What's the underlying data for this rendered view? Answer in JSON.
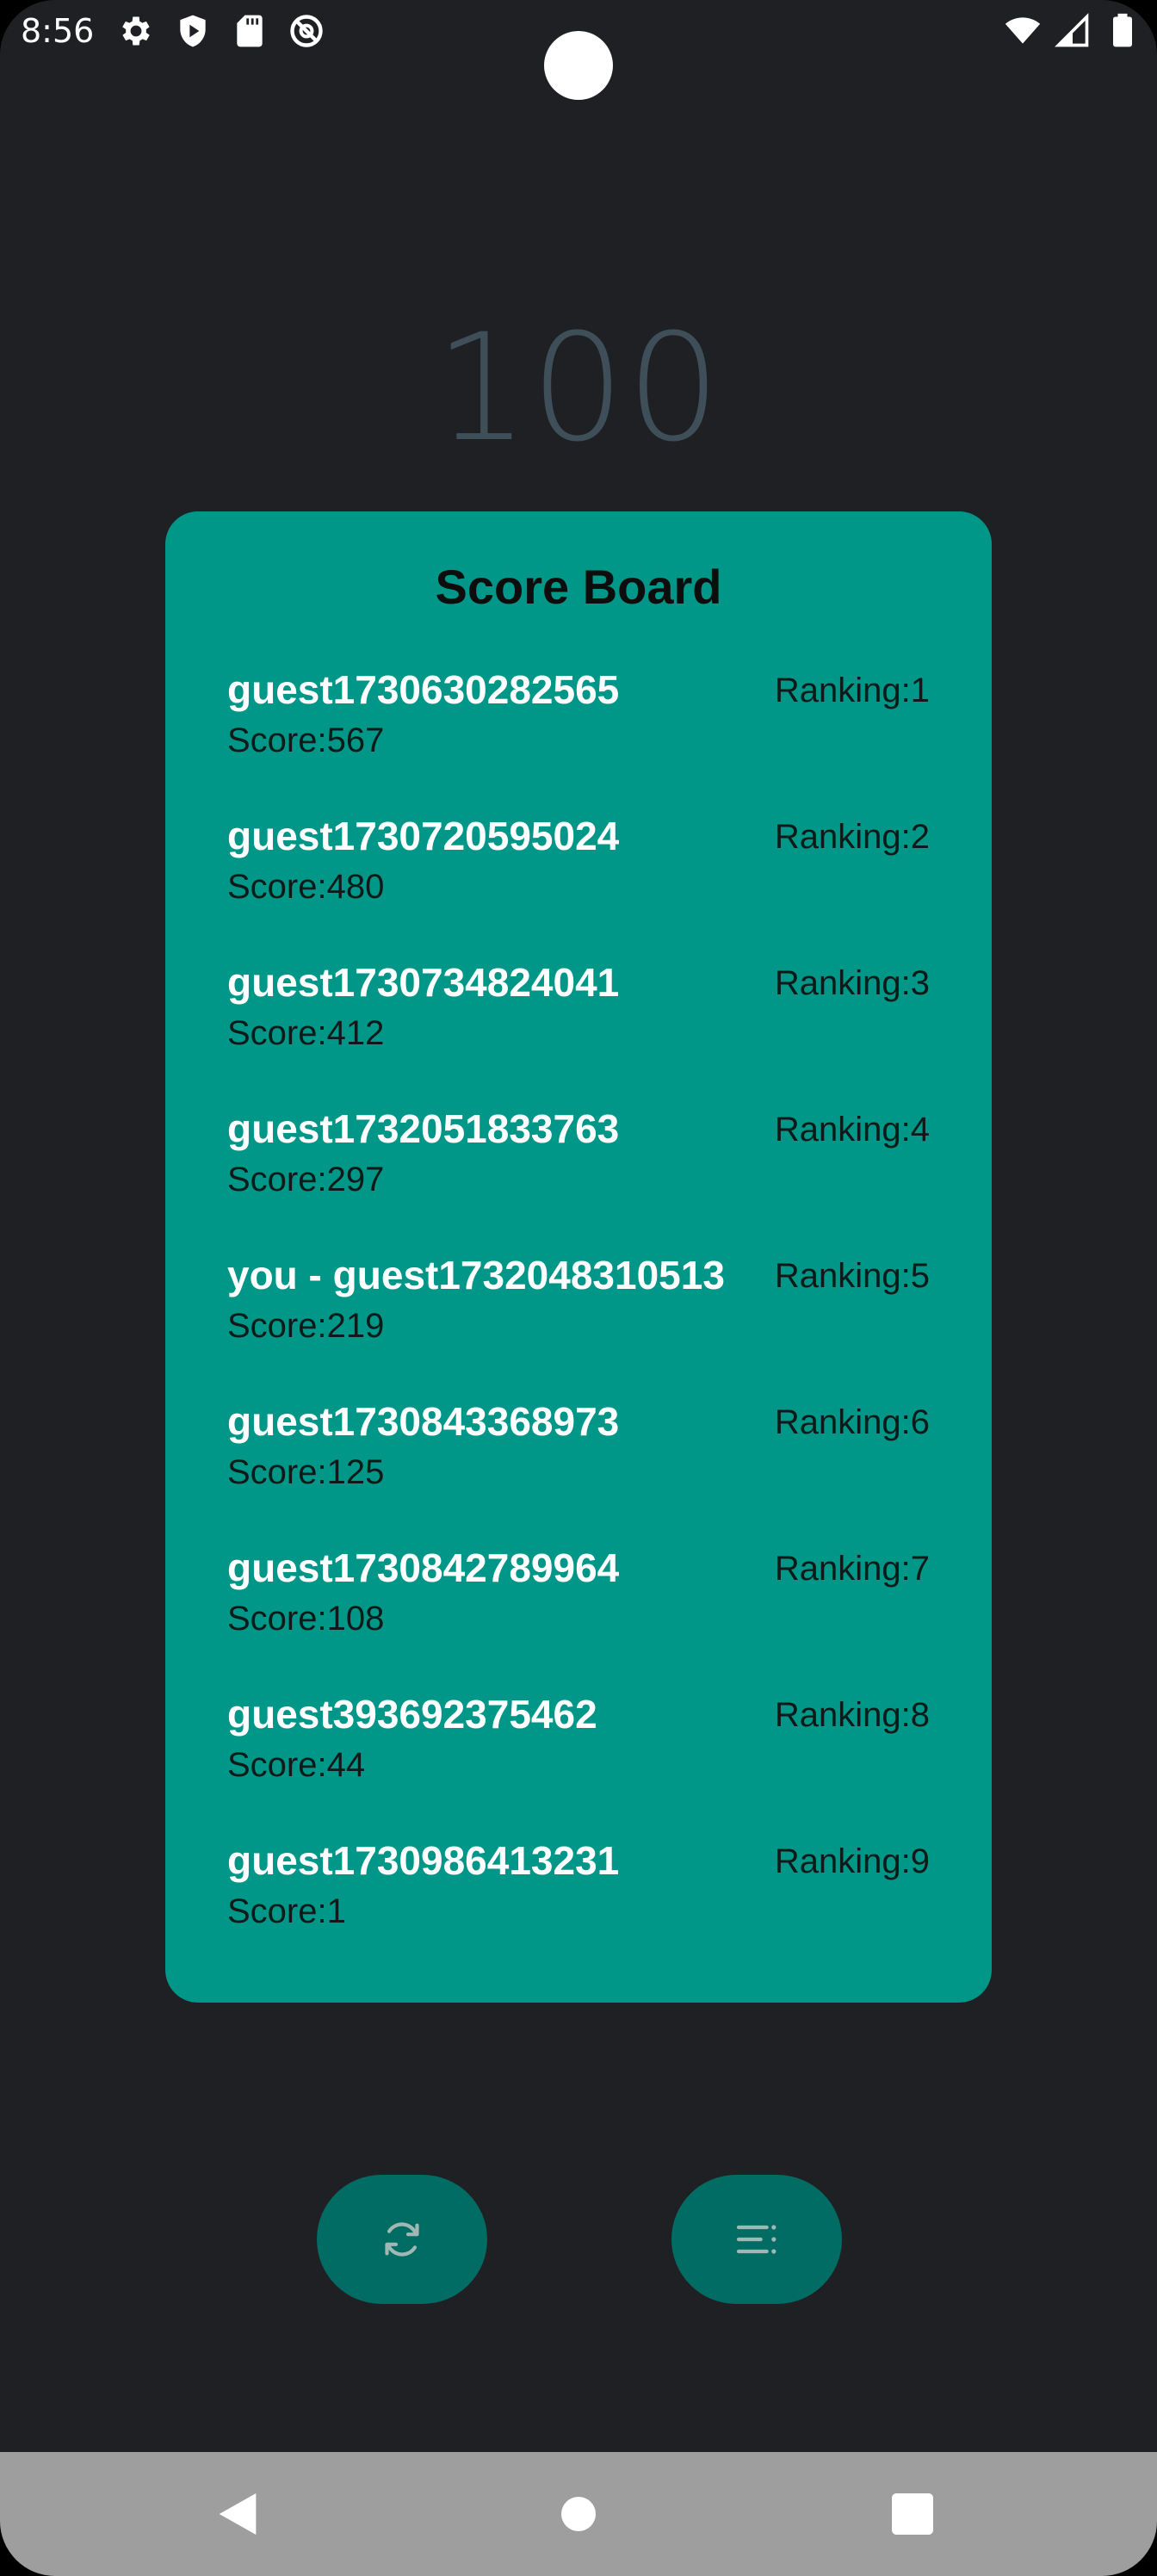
{
  "status_bar": {
    "time": "8:56",
    "icons_left": [
      "settings-icon",
      "shield-icon",
      "sd-card-icon",
      "no-disturb-icon"
    ],
    "icons_right": [
      "wifi-icon",
      "signal-icon",
      "battery-icon"
    ]
  },
  "game": {
    "current_score": "100"
  },
  "score_board": {
    "title": "Score Board",
    "entries": [
      {
        "player": "guest1730630282565",
        "score": "Score:567",
        "ranking": "Ranking:1"
      },
      {
        "player": "guest1730720595024",
        "score": "Score:480",
        "ranking": "Ranking:2"
      },
      {
        "player": "guest1730734824041",
        "score": "Score:412",
        "ranking": "Ranking:3"
      },
      {
        "player": "guest1732051833763",
        "score": "Score:297",
        "ranking": "Ranking:4"
      },
      {
        "player": "you - guest1732048310513",
        "score": "Score:219",
        "ranking": "Ranking:5"
      },
      {
        "player": "guest1730843368973",
        "score": "Score:125",
        "ranking": "Ranking:6"
      },
      {
        "player": "guest1730842789964",
        "score": "Score:108",
        "ranking": "Ranking:7"
      },
      {
        "player": "guest393692375462",
        "score": "Score:44",
        "ranking": "Ranking:8"
      },
      {
        "player": "guest1730986413231",
        "score": "Score:1",
        "ranking": "Ranking:9"
      }
    ]
  },
  "actions": {
    "refresh_icon": "refresh-icon",
    "menu_icon": "menu-icon"
  },
  "colors": {
    "background": "#1f2023",
    "board": "#009688",
    "fab": "#006c63",
    "score_text": "#3f4f5a",
    "nav_bar": "#9e9e9e"
  },
  "nav_bar": {
    "buttons": [
      "back-icon",
      "home-icon",
      "recents-icon"
    ]
  }
}
